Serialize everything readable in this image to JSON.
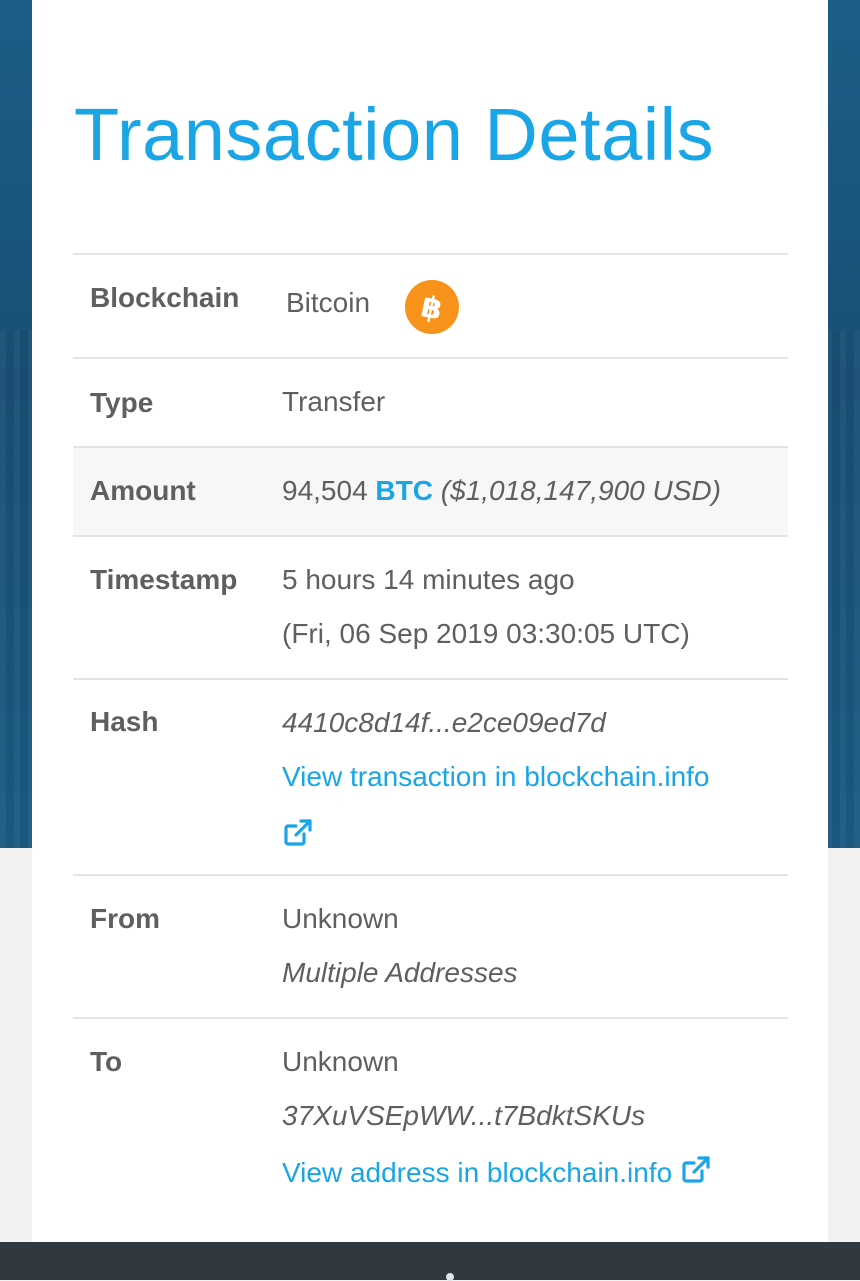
{
  "page": {
    "title": "Transaction Details"
  },
  "rows": {
    "blockchain": {
      "label": "Blockchain",
      "value": "Bitcoin",
      "icon": "bitcoin-icon"
    },
    "type": {
      "label": "Type",
      "value": "Transfer"
    },
    "amount": {
      "label": "Amount",
      "quantity": "94,504",
      "unit": "BTC",
      "usd": "($1,018,147,900 USD)"
    },
    "timestamp": {
      "label": "Timestamp",
      "relative": "5 hours 14 minutes ago",
      "absolute": "(Fri, 06 Sep 2019 03:30:05 UTC)"
    },
    "hash": {
      "label": "Hash",
      "value": "4410c8d14f...e2ce09ed7d",
      "link_text": "View transaction in blockchain.info",
      "link_icon": "external-link-icon"
    },
    "from": {
      "label": "From",
      "owner": "Unknown",
      "address": "Multiple Addresses"
    },
    "to": {
      "label": "To",
      "owner": "Unknown",
      "address": "37XuVSEpWW...t7BdktSKUs",
      "link_text": "View address in blockchain.info",
      "link_icon": "external-link-icon"
    }
  },
  "colors": {
    "accent": "#1aa5e6",
    "bitcoin_orange": "#f7931a",
    "text": "#5f5f5f",
    "header_background": "#1b5e86"
  }
}
